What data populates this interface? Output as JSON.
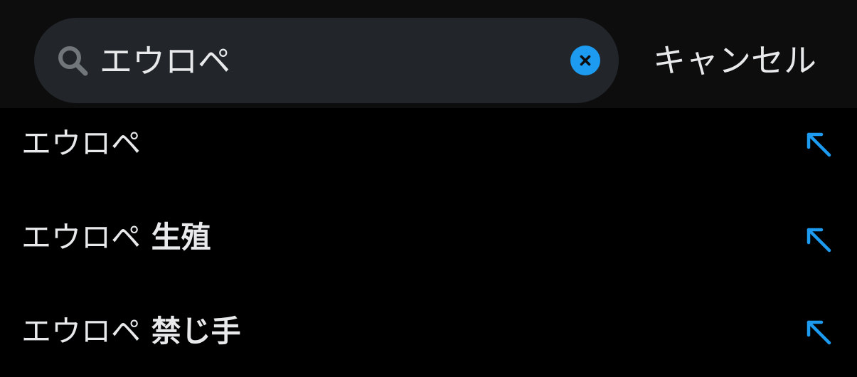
{
  "search": {
    "query": "エウロペ",
    "clear_icon": "close-circle-icon",
    "search_icon": "search-icon",
    "cancel_label": "キャンセル"
  },
  "colors": {
    "accent": "#1d9bf0",
    "text": "#e7e9ea",
    "pill": "#22262b",
    "background": "#000000"
  },
  "suggestions": [
    {
      "base": "エウロペ",
      "extra": "",
      "icon": "arrow-up-left-icon"
    },
    {
      "base": "エウロペ",
      "extra": " 生殖",
      "icon": "arrow-up-left-icon"
    },
    {
      "base": "エウロペ",
      "extra": " 禁じ手",
      "icon": "arrow-up-left-icon"
    }
  ]
}
